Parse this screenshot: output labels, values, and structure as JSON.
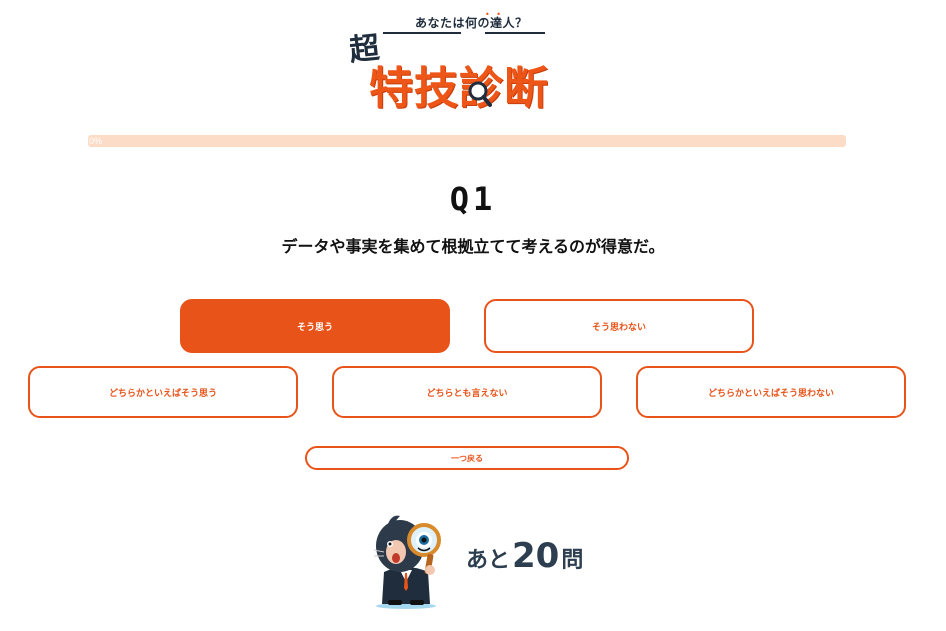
{
  "logo": {
    "subtitle": "あなたは何の達人？",
    "super": "超",
    "main": "特技診断",
    "icon": "magnifier-icon"
  },
  "progress": {
    "percent": 0,
    "label": "0%"
  },
  "question": {
    "number": "Q1",
    "text": "データや事実を集めて根拠立てて考えるのが得意だ。"
  },
  "answers": {
    "agree": "そう思う",
    "disagree": "そう思わない",
    "somewhat_agree": "どちらかといえばそう思う",
    "neutral": "どちらとも言えない",
    "somewhat_disagree": "どちらかといえばそう思わない",
    "selected": "agree"
  },
  "back": {
    "label": "一つ戻る"
  },
  "remaining": {
    "prefix": "あと",
    "count": "20",
    "suffix": "問",
    "mascot_icon": "detective-mascot-icon"
  },
  "colors": {
    "accent": "#e8531a",
    "track": "#fcdcc6",
    "navy": "#2c3e50"
  }
}
